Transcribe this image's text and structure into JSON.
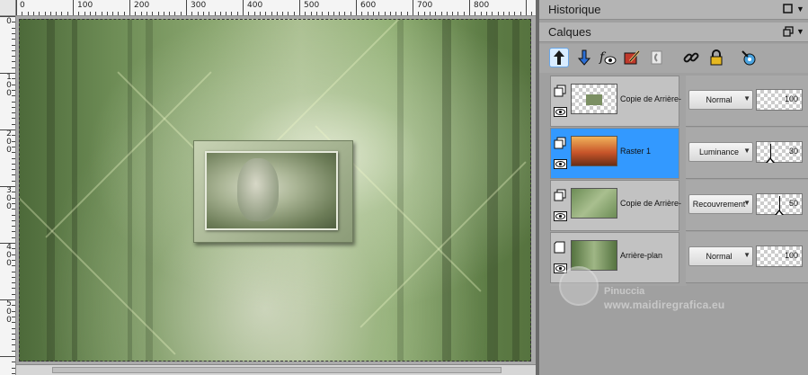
{
  "ruler": {
    "top_labels": [
      "0",
      "100",
      "200",
      "300",
      "400",
      "500",
      "600",
      "700",
      "800"
    ],
    "left_labels": [
      "0",
      "1 0 0",
      "2 0 0",
      "3 0 0",
      "4 0 0",
      "5 0 0"
    ]
  },
  "panels": {
    "history": {
      "title": "Historique"
    },
    "layers": {
      "title": "Calques"
    }
  },
  "toolbar": {
    "tools": [
      {
        "name": "move-layer-up-icon"
      },
      {
        "name": "move-layer-down-icon"
      },
      {
        "name": "layer-effects-icon"
      },
      {
        "name": "edit-selection-icon"
      },
      {
        "name": "new-layer-icon"
      },
      {
        "name": "link-layer-icon"
      },
      {
        "name": "lock-transparency-icon"
      },
      {
        "name": "layer-properties-icon"
      }
    ]
  },
  "layers": [
    {
      "name": "Copie de Arrière-",
      "blend": "Normal",
      "opacity": "100",
      "selected": false
    },
    {
      "name": "Raster 1",
      "blend": "Luminance",
      "opacity": "30",
      "selected": true
    },
    {
      "name": "Copie de Arrière-",
      "blend": "Recouvrement",
      "opacity": "50",
      "selected": false
    },
    {
      "name": "Arrière-plan",
      "blend": "Normal",
      "opacity": "100",
      "selected": false
    }
  ],
  "colors": {
    "selected_row": "#3399ff",
    "panel_bg": "#a0a0a0"
  },
  "watermark": {
    "name": "Pinuccia",
    "url": "www.maidiregrafica.eu"
  }
}
